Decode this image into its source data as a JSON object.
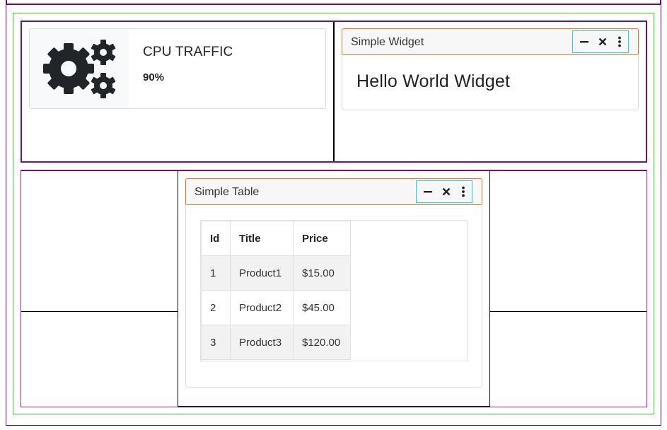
{
  "info_box": {
    "icon": "gears-icon",
    "title": "CPU TRAFFIC",
    "value": "90%"
  },
  "simple_widget": {
    "title": "Simple Widget",
    "body_text": "Hello World Widget",
    "tools": [
      "minus-icon",
      "close-icon",
      "more-vertical-icon"
    ]
  },
  "simple_table": {
    "title": "Simple Table",
    "tools": [
      "minus-icon",
      "close-icon",
      "more-vertical-icon"
    ],
    "columns": [
      "Id",
      "Title",
      "Price"
    ],
    "rows": [
      [
        "1",
        "Product1",
        "$15.00"
      ],
      [
        "2",
        "Product2",
        "$45.00"
      ],
      [
        "3",
        "Product3",
        "$120.00"
      ]
    ]
  },
  "colors": {
    "widget_header_border": "#e87722",
    "tools_border": "#1fd6e0",
    "layout_frame": "#7a0f7a",
    "container_border": "#3ad13a",
    "icon_color": "#212529"
  }
}
